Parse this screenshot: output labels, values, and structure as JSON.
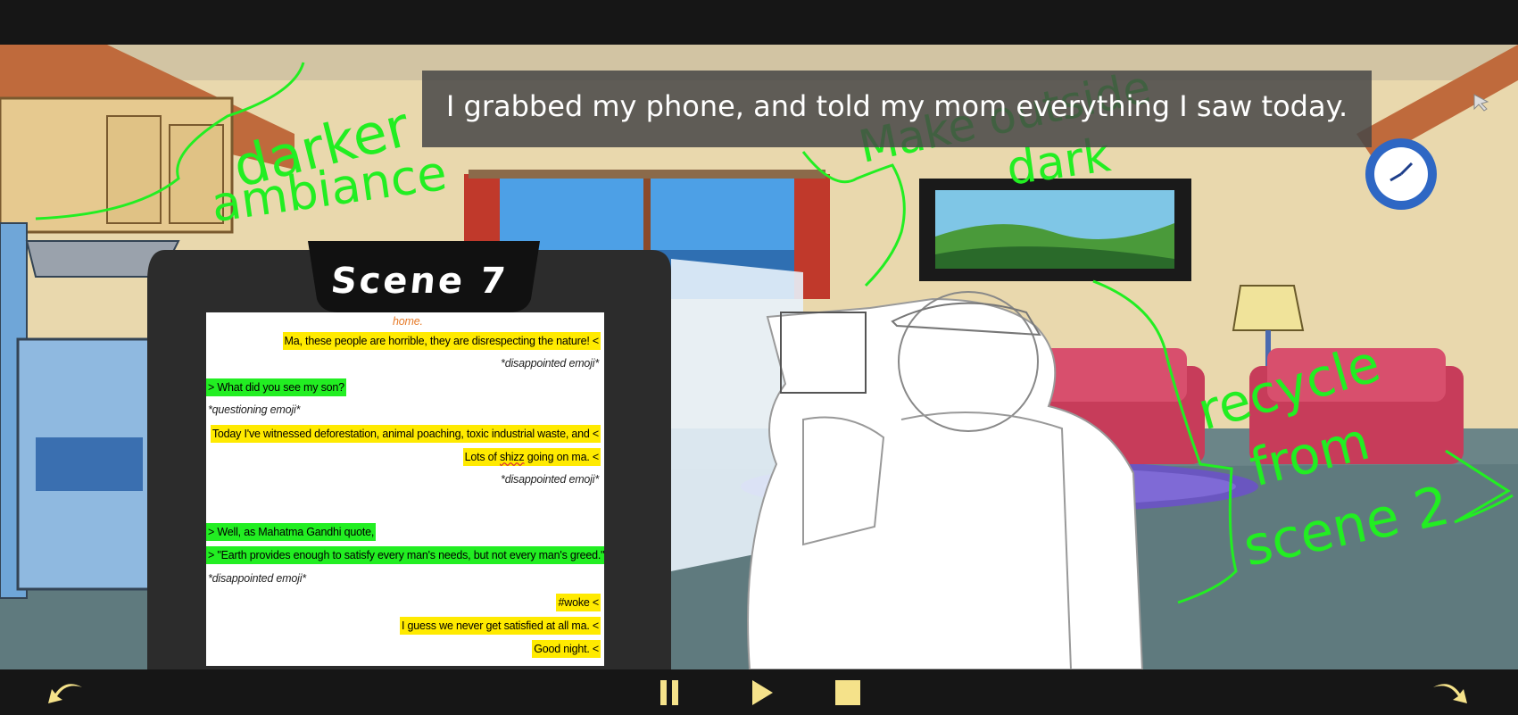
{
  "caption": "I grabbed my phone, and told my mom everything I saw today.",
  "scene_title": "Scene 7",
  "chat": {
    "top_fragment": "home.",
    "messages": [
      {
        "side": "right",
        "style": "yellow",
        "text": "Ma, these people are horrible, they are disrespecting the nature! <"
      },
      {
        "side": "right",
        "style": "note",
        "text": "*disappointed emoji*"
      },
      {
        "side": "left",
        "style": "green",
        "text": "> What did you see my son?"
      },
      {
        "side": "left",
        "style": "note",
        "text": "*questioning emoji*"
      },
      {
        "side": "right",
        "style": "yellow",
        "text": "Today I've witnessed deforestation, animal poaching, toxic industrial waste, and <"
      },
      {
        "side": "right",
        "style": "yellow",
        "text_parts": [
          "Lots of ",
          "shizz",
          " going on ma. <"
        ]
      },
      {
        "side": "right",
        "style": "note",
        "text": "*disappointed emoji*"
      },
      {
        "side": "left",
        "style": "green",
        "text": "> Well, as Mahatma Gandhi quote,"
      },
      {
        "side": "left",
        "style": "green",
        "text": "> \"Earth provides enough to satisfy every man's needs, but not every man's greed.\""
      },
      {
        "side": "left",
        "style": "note",
        "text": "*disappointed emoji*"
      },
      {
        "side": "right",
        "style": "yellow",
        "text": "#woke <"
      },
      {
        "side": "right",
        "style": "yellow",
        "text": "I guess we never get satisfied at all ma. <"
      },
      {
        "side": "right",
        "style": "yellow",
        "text": "Good night. <"
      }
    ]
  },
  "annotations": {
    "darker_1": "darker",
    "darker_2": "ambiance",
    "make_1": "Make outside",
    "make_2": "dark",
    "recycle_1": "recycle",
    "recycle_2": "from",
    "recycle_3": "scene 2"
  },
  "controls": {
    "back": "back-arrow-icon",
    "pause": "pause-icon",
    "play": "play-icon",
    "stop": "stop-icon",
    "forward": "forward-arrow-icon"
  },
  "colors": {
    "annotation_green": "#22ee22",
    "control_yellow": "#f5e28a",
    "bubble_yellow": "#ffea00",
    "bubble_green": "#22ee22"
  }
}
